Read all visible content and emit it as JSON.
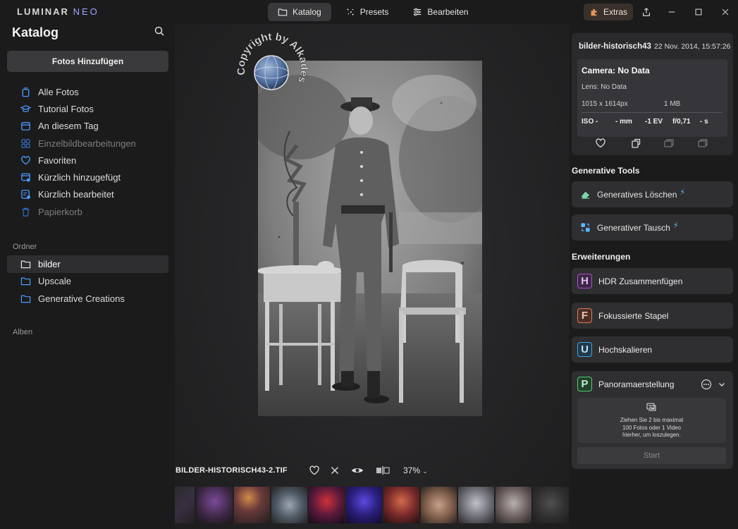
{
  "app": {
    "logo_main": "LUMINAR",
    "logo_sub": "NEO"
  },
  "topnav": {
    "tabs": [
      {
        "label": "Katalog",
        "icon": "folder-icon",
        "active": true
      },
      {
        "label": "Presets",
        "icon": "sparkle-icon",
        "active": false
      },
      {
        "label": "Bearbeiten",
        "icon": "sliders-icon",
        "active": false
      }
    ],
    "extras_label": "Extras"
  },
  "sidebar": {
    "title": "Katalog",
    "add_photos": "Fotos Hinzufügen",
    "items": [
      {
        "label": "Alle Fotos",
        "icon": "photos-stack-icon",
        "dim": false
      },
      {
        "label": "Tutorial Fotos",
        "icon": "graduation-cap-icon",
        "dim": false
      },
      {
        "label": "An diesem Tag",
        "icon": "calendar-icon",
        "dim": false
      },
      {
        "label": "Einzelbildbearbeitungen",
        "icon": "grid-icon",
        "dim": true
      },
      {
        "label": "Favoriten",
        "icon": "heart-icon",
        "dim": false
      },
      {
        "label": "Kürzlich hinzugefügt",
        "icon": "recent-added-icon",
        "dim": false
      },
      {
        "label": "Kürzlich bearbeitet",
        "icon": "recent-edited-icon",
        "dim": false
      },
      {
        "label": "Papierkorb",
        "icon": "trash-icon",
        "dim": true
      }
    ],
    "folders_label": "Ordner",
    "folders": [
      {
        "label": "bilder",
        "active": true
      },
      {
        "label": "Upscale",
        "active": false
      },
      {
        "label": "Generative Creations",
        "active": false
      }
    ],
    "albums_label": "Alben"
  },
  "viewer": {
    "watermark_text": "Copyright by Alkadesign.eu",
    "filename": "BILDER-HISTORISCH43-2.TIF",
    "zoom": "37%"
  },
  "info": {
    "filename": "bilder-historisch43",
    "date": "22 Nov. 2014, 15:57:26",
    "camera": "Camera: No Data",
    "lens": "Lens: No Data",
    "dimensions": "1015 x 1614px",
    "filesize": "1 MB",
    "iso": "ISO -",
    "focal": "- mm",
    "ev": "-1 EV",
    "aperture": "f/0,71",
    "shutter": "- s"
  },
  "generative": {
    "heading": "Generative Tools",
    "tools": [
      {
        "label": "Generatives Löschen"
      },
      {
        "label": "Generativer Tausch"
      }
    ]
  },
  "extensions": {
    "heading": "Erweiterungen",
    "items": [
      {
        "letter": "H",
        "label": "HDR Zusammenfügen",
        "color": "#b04bd6"
      },
      {
        "letter": "F",
        "label": "Fokussierte Stapel",
        "color": "#e07a52"
      },
      {
        "letter": "U",
        "label": "Hochskalieren",
        "color": "#3aa6e8"
      }
    ],
    "panorama": {
      "letter": "P",
      "label": "Panoramaerstellung",
      "color": "#4ccf6a",
      "drop_line1": "Ziehen Sie 2 bis maximal",
      "drop_line2": "100 Fotos oder 1 Video",
      "drop_line3": "hierher, um loszulegen.",
      "start": "Start"
    }
  },
  "colors": {
    "accent_blue": "#4a9bff",
    "extras_bg": "#3a302b",
    "bolt": "#4fc3ff"
  }
}
